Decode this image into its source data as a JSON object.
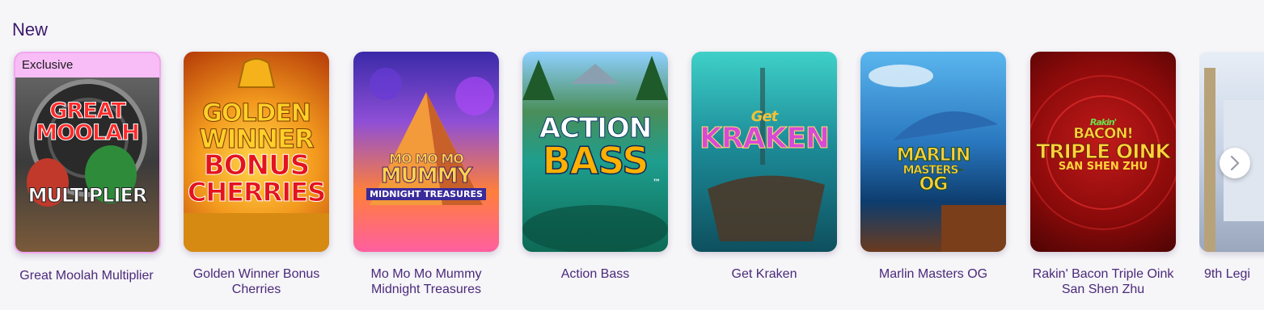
{
  "section": {
    "title": "New"
  },
  "games": [
    {
      "title": "Great Moolah Multiplier",
      "badge": "Exclusive",
      "logo": [
        "GREAT",
        "MOOLAH",
        "MULTIPLIER"
      ]
    },
    {
      "title": "Golden Winner Bonus Cherries",
      "logo": [
        "GOLDEN",
        "WINNER",
        "BONUS",
        "CHERRIES"
      ]
    },
    {
      "title": "Mo Mo Mo Mummy Midnight Treasures",
      "logo": [
        "MO MO MO",
        "MUMMY",
        "MIDNIGHT TREASURES"
      ]
    },
    {
      "title": "Action Bass",
      "logo": [
        "ACTION",
        "BASS",
        "™"
      ]
    },
    {
      "title": "Get Kraken",
      "logo": [
        "Get",
        "KRAKEN"
      ]
    },
    {
      "title": "Marlin Masters OG",
      "logo": [
        "MARLIN",
        "MASTERS",
        "™",
        "OG"
      ]
    },
    {
      "title": "Rakin' Bacon Triple Oink San Shen Zhu",
      "logo": [
        "Rakin'",
        "BACON!",
        "TRIPLE OINK",
        "SAN SHEN ZHU"
      ]
    },
    {
      "title": "9th Legi"
    }
  ],
  "icons": {
    "next": "chevron-right-icon"
  },
  "colors": {
    "title": "#3c1a6b",
    "caption": "#4a2a7a",
    "badge_bg": "#f8bdf6",
    "page_bg": "#f6f5f8"
  }
}
